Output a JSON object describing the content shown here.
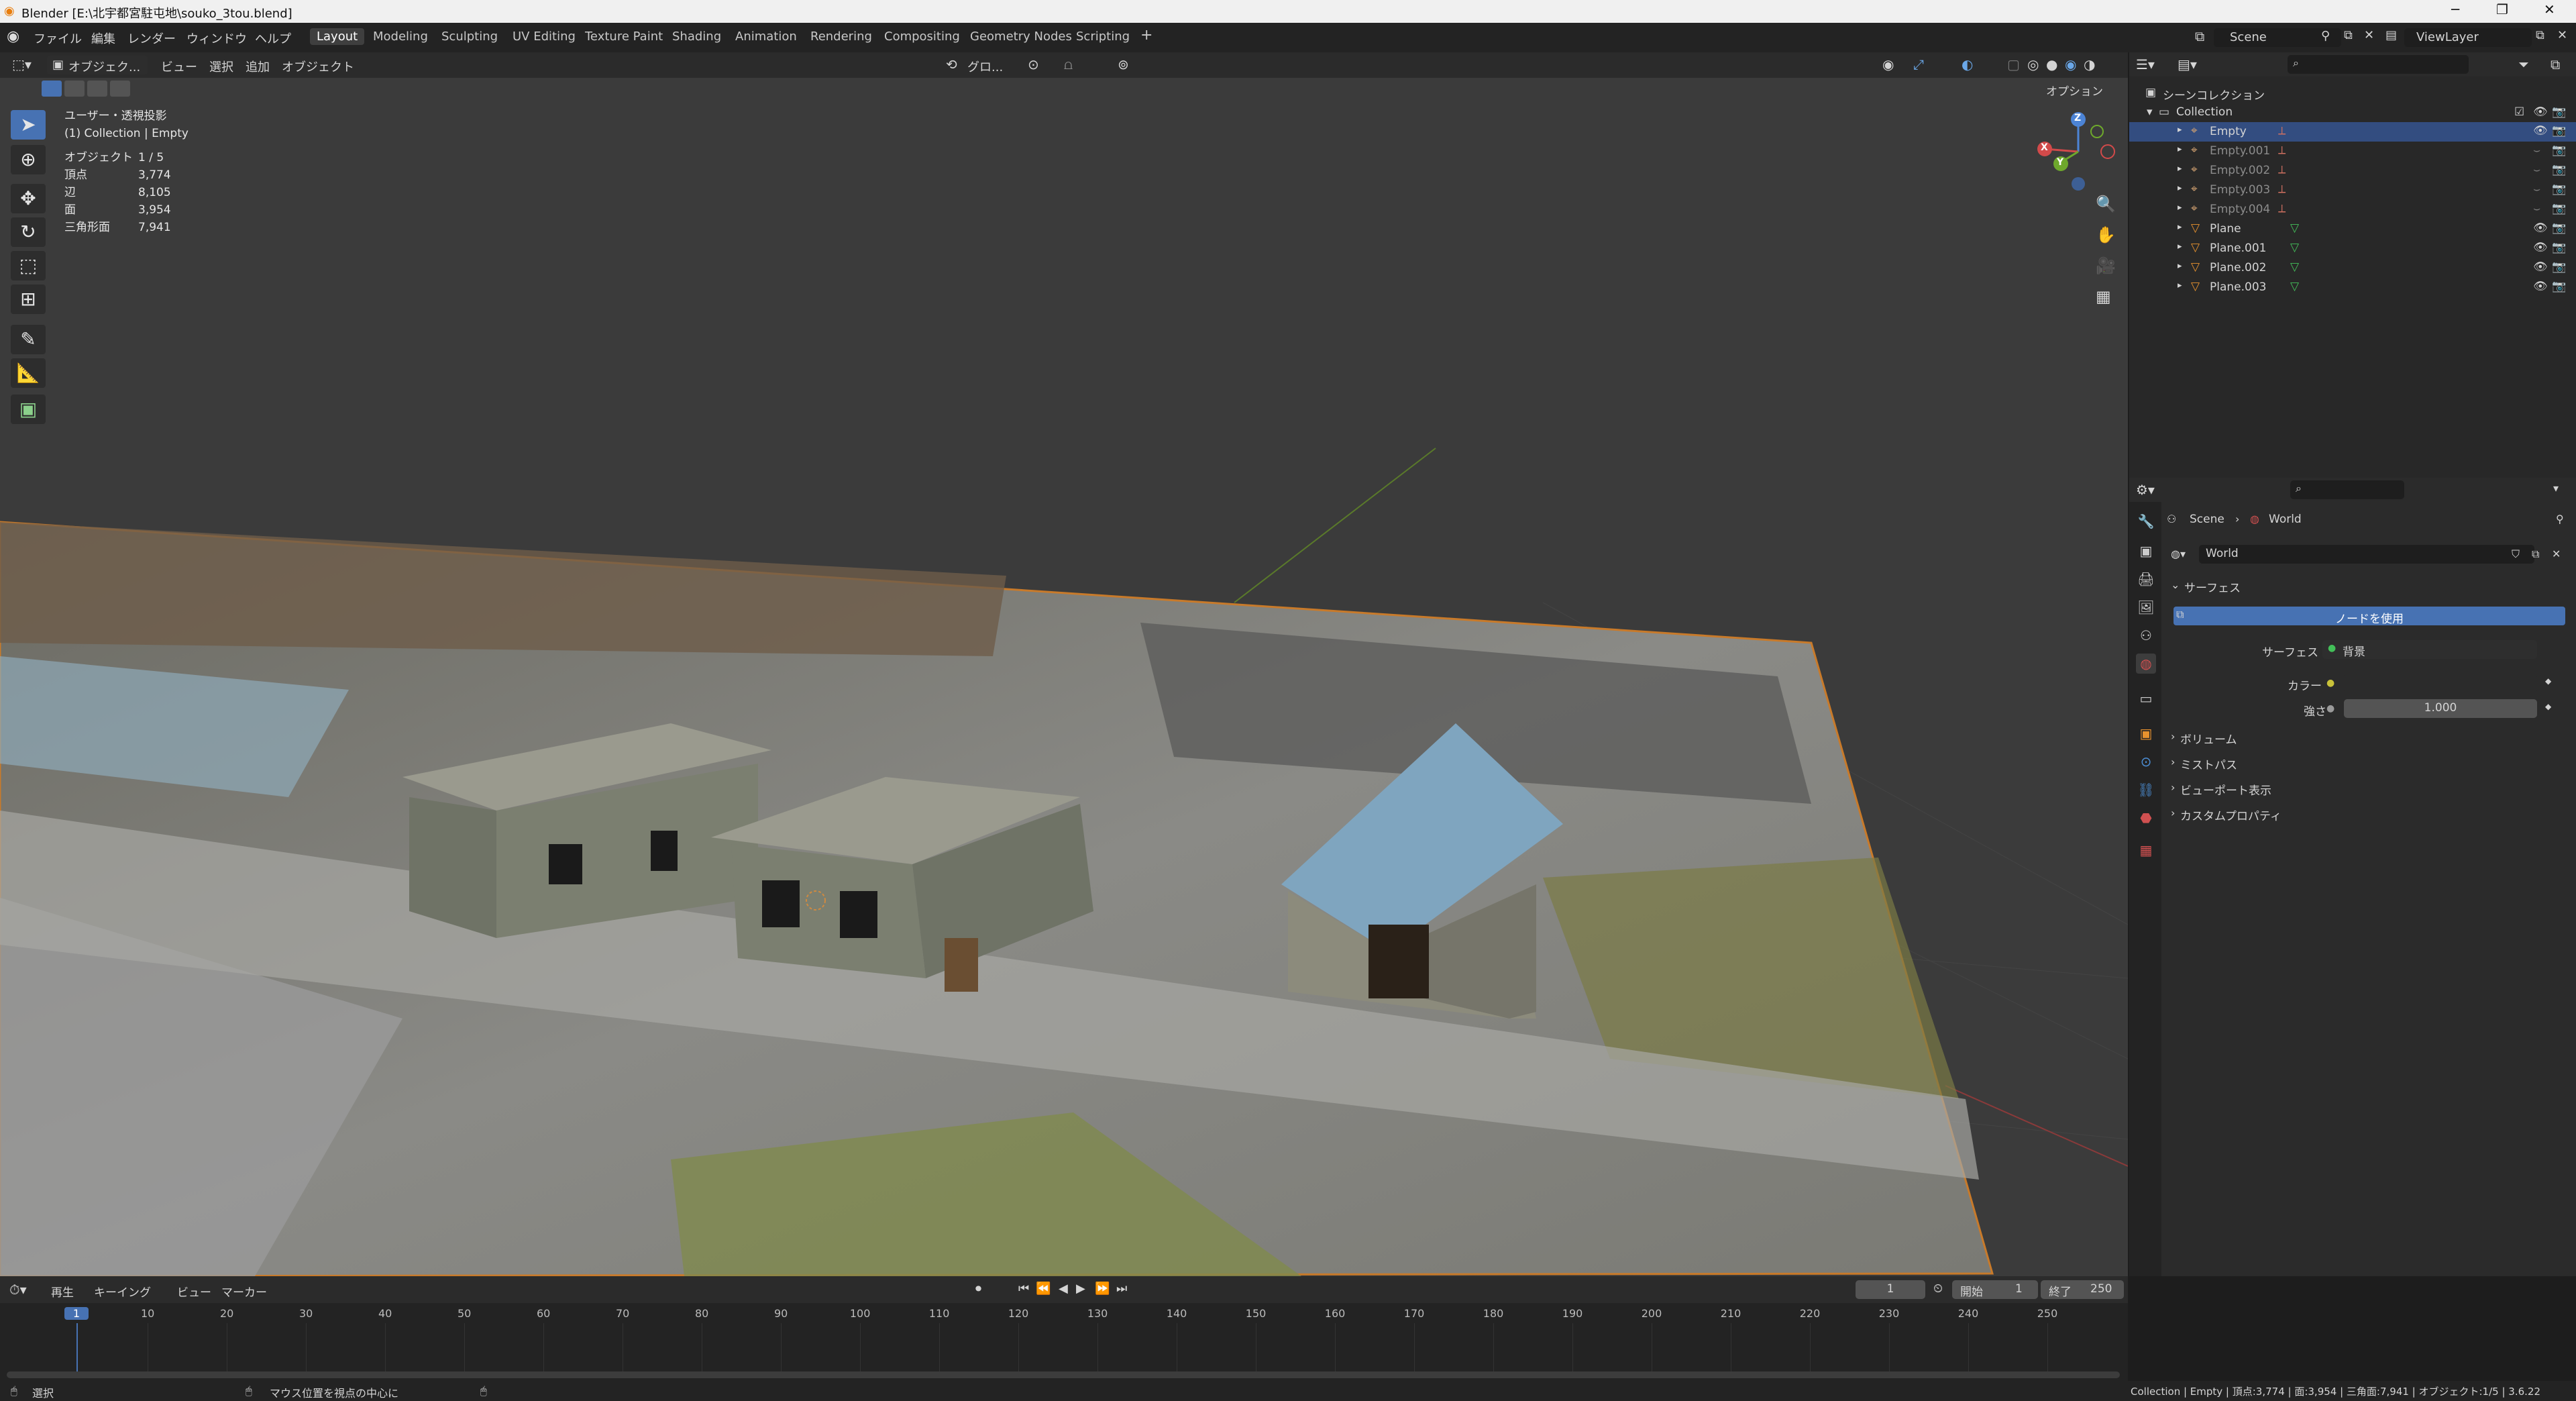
{
  "window": {
    "title": "Blender [E:\\北宇都宮駐屯地\\souko_3tou.blend]"
  },
  "menus": [
    "ファイル",
    "編集",
    "レンダー",
    "ウィンドウ",
    "ヘルプ"
  ],
  "workspaces": [
    "Layout",
    "Modeling",
    "Sculpting",
    "UV Editing",
    "Texture Paint",
    "Shading",
    "Animation",
    "Rendering",
    "Compositing",
    "Geometry Nodes",
    "Scripting",
    "+"
  ],
  "active_workspace": "Layout",
  "scene_field": "Scene",
  "viewlayer_field": "ViewLayer",
  "viewport": {
    "mode": "オブジェク...",
    "menus": [
      "ビュー",
      "選択",
      "追加",
      "オブジェクト"
    ],
    "transform": "グロ...",
    "options": "オプション",
    "view_name": "ユーザー・透視投影",
    "context": "(1) Collection | Empty",
    "stats": [
      {
        "label": "オブジェクト",
        "value": "1 / 5"
      },
      {
        "label": "頂点",
        "value": "3,774"
      },
      {
        "label": "辺",
        "value": "8,105"
      },
      {
        "label": "面",
        "value": "3,954"
      },
      {
        "label": "三角形面",
        "value": "7,941"
      }
    ],
    "gizmo_axes": [
      "X",
      "Y",
      "Z"
    ]
  },
  "outliner": {
    "root": "シーンコレクション",
    "collection": "Collection",
    "items": [
      {
        "name": "Empty",
        "type": "empty",
        "selected": true,
        "hidden": false
      },
      {
        "name": "Empty.001",
        "type": "empty",
        "selected": false,
        "hidden": true
      },
      {
        "name": "Empty.002",
        "type": "empty",
        "selected": false,
        "hidden": true
      },
      {
        "name": "Empty.003",
        "type": "empty",
        "selected": false,
        "hidden": true
      },
      {
        "name": "Empty.004",
        "type": "empty",
        "selected": false,
        "hidden": true
      },
      {
        "name": "Plane",
        "type": "mesh",
        "selected": false,
        "hidden": false
      },
      {
        "name": "Plane.001",
        "type": "mesh",
        "selected": false,
        "hidden": false
      },
      {
        "name": "Plane.002",
        "type": "mesh",
        "selected": false,
        "hidden": false
      },
      {
        "name": "Plane.003",
        "type": "mesh",
        "selected": false,
        "hidden": false
      }
    ]
  },
  "properties": {
    "breadcrumb": [
      "Scene",
      "World"
    ],
    "world_field": "World",
    "surface_panel": "サーフェス",
    "use_nodes": "ノードを使用",
    "surface_label": "サーフェス",
    "surface_value": "背景",
    "color_label": "カラー",
    "strength_label": "強さ",
    "strength_value": "1.000",
    "panels": [
      "ボリューム",
      "ミストパス",
      "ビューポート表示",
      "カスタムプロパティ"
    ]
  },
  "timeline": {
    "menus": [
      "再生",
      "キーイング",
      "ビュー",
      "マーカー"
    ],
    "current_frame": "1",
    "start_label": "開始",
    "start": "1",
    "end_label": "終了",
    "end": "250",
    "ticks": [
      "1",
      "10",
      "20",
      "30",
      "40",
      "50",
      "60",
      "70",
      "80",
      "90",
      "100",
      "110",
      "120",
      "130",
      "140",
      "150",
      "160",
      "170",
      "180",
      "190",
      "200",
      "210",
      "220",
      "230",
      "240",
      "250"
    ]
  },
  "statusbar": {
    "select": "選択",
    "center": "マウス位置を視点の中心に",
    "info": "Collection | Empty | 頂点:3,774 | 面:3,954 | 三角面:7,941 | オブジェクト:1/5 | 3.6.22"
  },
  "colors": {
    "accent": "#4772b3",
    "selection": "#334d80",
    "background": "#3b3b3b"
  }
}
